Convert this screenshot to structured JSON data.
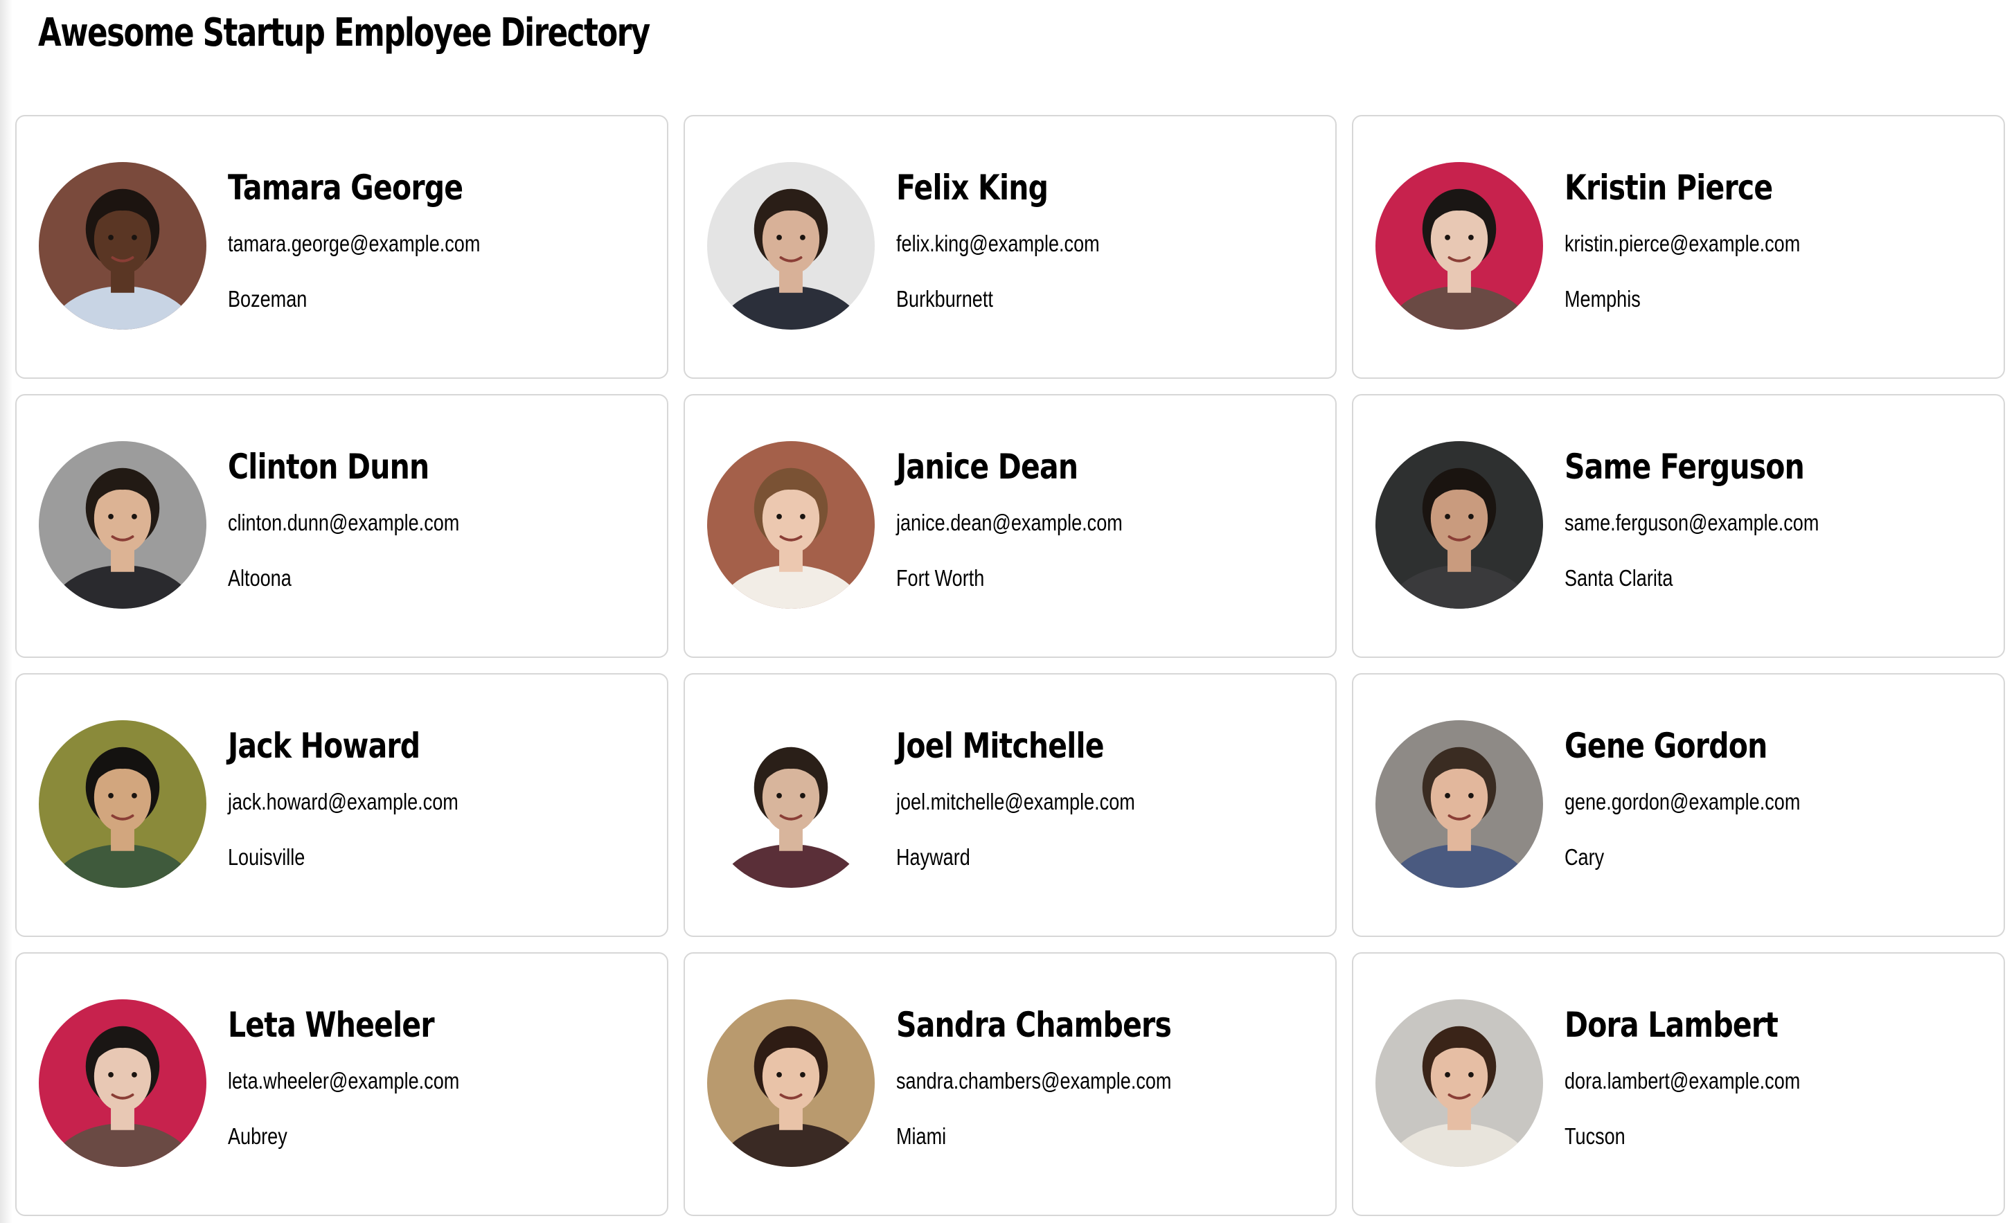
{
  "page": {
    "title": "Awesome Startup Employee Directory"
  },
  "employees": [
    {
      "name": "Tamara George",
      "email": "tamara.george@example.com",
      "city": "Bozeman",
      "bg": "#7a4a3c",
      "skin": "#5a3624",
      "hair": "#1c1410",
      "shirt": "#c8d4e4"
    },
    {
      "name": "Felix King",
      "email": "felix.king@example.com",
      "city": "Burkburnett",
      "bg": "#e4e4e4",
      "skin": "#d8b198",
      "hair": "#2a1e17",
      "shirt": "#2b2f3a"
    },
    {
      "name": "Kristin Pierce",
      "email": "kristin.pierce@example.com",
      "city": "Memphis",
      "bg": "#c7224d",
      "skin": "#e8c8b4",
      "hair": "#1a1614",
      "shirt": "#6a4a44"
    },
    {
      "name": "Clinton Dunn",
      "email": "clinton.dunn@example.com",
      "city": "Altoona",
      "bg": "#9c9c9c",
      "skin": "#dcb394",
      "hair": "#221a14",
      "shirt": "#2a2a2e"
    },
    {
      "name": "Janice Dean",
      "email": "janice.dean@example.com",
      "city": "Fort Worth",
      "bg": "#a4604a",
      "skin": "#ecc8b0",
      "hair": "#7a5234",
      "shirt": "#f2ede6"
    },
    {
      "name": "Same Ferguson",
      "email": "same.ferguson@example.com",
      "city": "Santa Clarita",
      "bg": "#2e3030",
      "skin": "#c99b7e",
      "hair": "#1a1410",
      "shirt": "#3a3a3c"
    },
    {
      "name": "Jack Howard",
      "email": "jack.howard@example.com",
      "city": "Louisville",
      "bg": "#8a8a3a",
      "skin": "#d2a67e",
      "hair": "#141210",
      "shirt": "#3f5a3c"
    },
    {
      "name": "Joel Mitchelle",
      "email": "joel.mitchelle@example.com",
      "city": "Hayward",
      "bg": "#ffffff",
      "skin": "#d8b59c",
      "hair": "#2a1f18",
      "shirt": "#5a2f38"
    },
    {
      "name": "Gene Gordon",
      "email": "gene.gordon@example.com",
      "city": "Cary",
      "bg": "#8e8a86",
      "skin": "#e2b79c",
      "hair": "#3a2c22",
      "shirt": "#4a5a80"
    },
    {
      "name": "Leta Wheeler",
      "email": "leta.wheeler@example.com",
      "city": "Aubrey",
      "bg": "#c7224d",
      "skin": "#e8c8b4",
      "hair": "#1a1614",
      "shirt": "#6a4a44"
    },
    {
      "name": "Sandra Chambers",
      "email": "sandra.chambers@example.com",
      "city": "Miami",
      "bg": "#b99a6e",
      "skin": "#e9c3a8",
      "hair": "#2e1c14",
      "shirt": "#3a2a24"
    },
    {
      "name": "Dora Lambert",
      "email": "dora.lambert@example.com",
      "city": "Tucson",
      "bg": "#c8c6c2",
      "skin": "#e6bea4",
      "hair": "#3a2418",
      "shirt": "#e8e4dc"
    }
  ]
}
